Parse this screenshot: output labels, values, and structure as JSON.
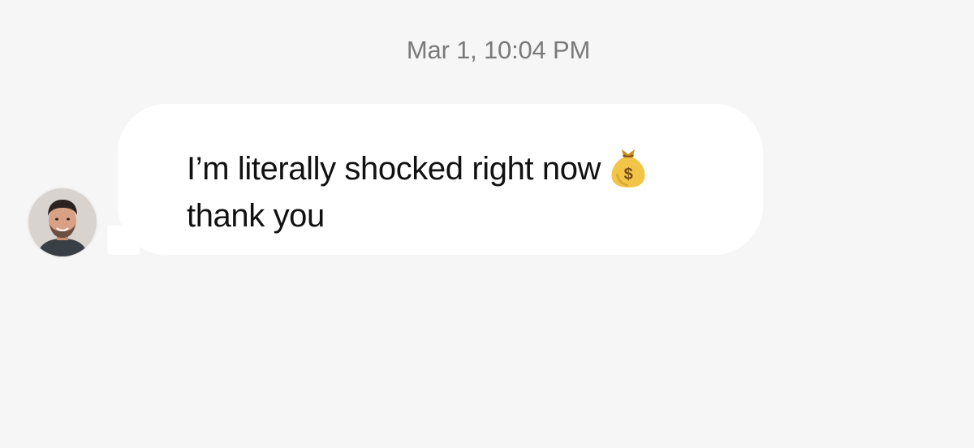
{
  "thread": {
    "timestamp": "Mar 1, 10:04 PM"
  },
  "message": {
    "sender_avatar_icon": "person-avatar",
    "line1": "I’m literally shocked right now",
    "line2": "thank you",
    "emoji": "money-bag-icon",
    "colors": {
      "bubble": "#ffffff",
      "background": "#f6f6f6",
      "timestamp": "#7a7a7a",
      "text": "#111111"
    }
  }
}
